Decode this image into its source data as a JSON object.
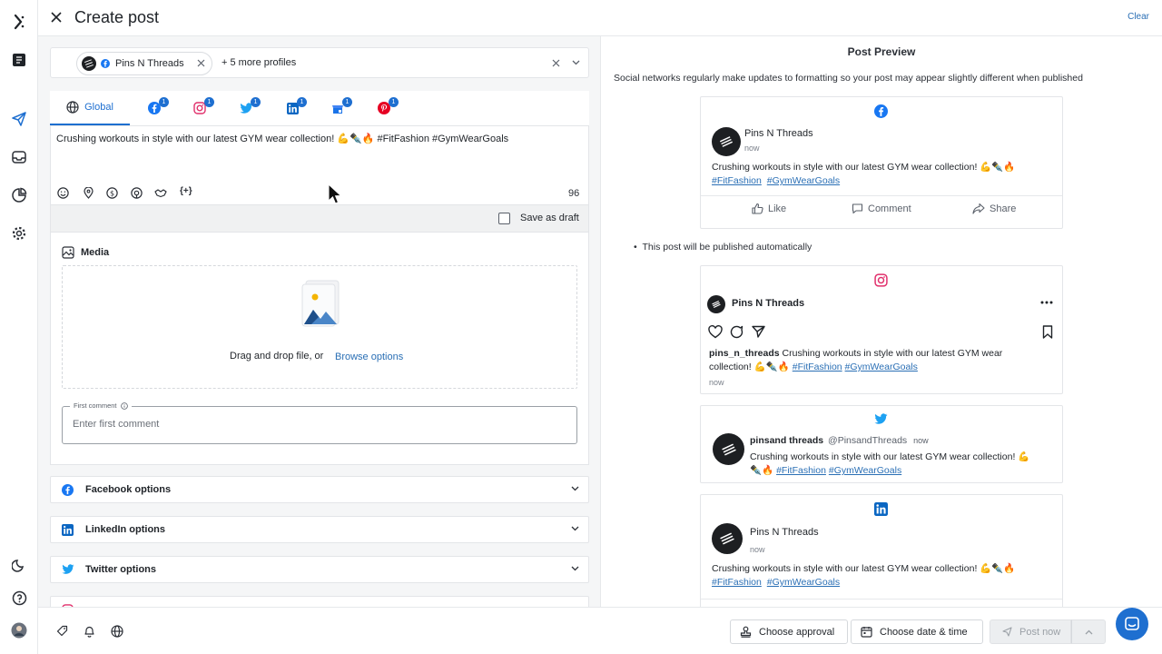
{
  "header": {
    "title": "Create post",
    "clear_label": "Clear"
  },
  "profiles": {
    "selected": "Pins N Threads",
    "more": "+ 5 more profiles"
  },
  "tabs": [
    {
      "label": "Global",
      "network": "globe",
      "badge": ""
    },
    {
      "label": "",
      "network": "facebook",
      "badge": "1"
    },
    {
      "label": "",
      "network": "instagram",
      "badge": "1"
    },
    {
      "label": "",
      "network": "twitter",
      "badge": "1"
    },
    {
      "label": "",
      "network": "linkedin",
      "badge": "1"
    },
    {
      "label": "",
      "network": "google-business",
      "badge": "1"
    },
    {
      "label": "",
      "network": "pinterest",
      "badge": "1"
    }
  ],
  "editor": {
    "text": "Crushing workouts in style with our latest GYM wear collection! 💪✒️🔥 #FitFashion #GymWearGoals",
    "char_count": "96"
  },
  "draft": {
    "label": "Save as draft"
  },
  "media": {
    "title": "Media",
    "drop_text": "Drag and drop file, or",
    "browse_label": "Browse options",
    "comment_label": "First comment",
    "comment_placeholder": "Enter first comment"
  },
  "options": [
    {
      "label": "Facebook options",
      "icon": "facebook-icon"
    },
    {
      "label": "LinkedIn options",
      "icon": "linkedin-icon"
    },
    {
      "label": "Twitter options",
      "icon": "twitter-icon"
    }
  ],
  "preview": {
    "title": "Post Preview",
    "note": "Social networks regularly make updates to formatting so your post may appear slightly different when published",
    "auto_note": "This post will be published automatically",
    "facebook": {
      "name": "Pins N Threads",
      "time": "now",
      "text": "Crushing workouts in style with our latest GYM wear collection! 💪✒️🔥",
      "tag1": "#FitFashion",
      "tag2": "#GymWearGoals",
      "like": "Like",
      "comment": "Comment",
      "share": "Share"
    },
    "instagram": {
      "name": "Pins N Threads",
      "handle": "pins_n_threads",
      "text_line1": "Crushing workouts in style with our latest GYM wear",
      "text_line2": "collection! 💪✒️🔥",
      "tag1": "#FitFashion",
      "tag2": "#GymWearGoals",
      "time": "now"
    },
    "twitter": {
      "name": "pinsand threads",
      "handle": "@PinsandThreads",
      "time": "now",
      "text_line1": "Crushing workouts in style with our latest GYM wear collection! 💪",
      "text_line2": "✒️🔥",
      "tag1": "#FitFashion",
      "tag2": "#GymWearGoals"
    },
    "linkedin": {
      "name": "Pins N Threads",
      "time": "now",
      "text": "Crushing workouts in style with our latest GYM wear collection! 💪✒️🔥",
      "tag1": "#FitFashion",
      "tag2": "#GymWearGoals"
    }
  },
  "footer": {
    "approval_label": "Choose approval",
    "schedule_label": "Choose date & time",
    "post_label": "Post now"
  },
  "colors": {
    "accent": "#1e6fd0",
    "link": "#2a6fb5",
    "facebook": "#1877f2",
    "instagram": "#e1306c",
    "twitter": "#1da1f2",
    "linkedin": "#0a66c2",
    "pinterest": "#e60023"
  }
}
